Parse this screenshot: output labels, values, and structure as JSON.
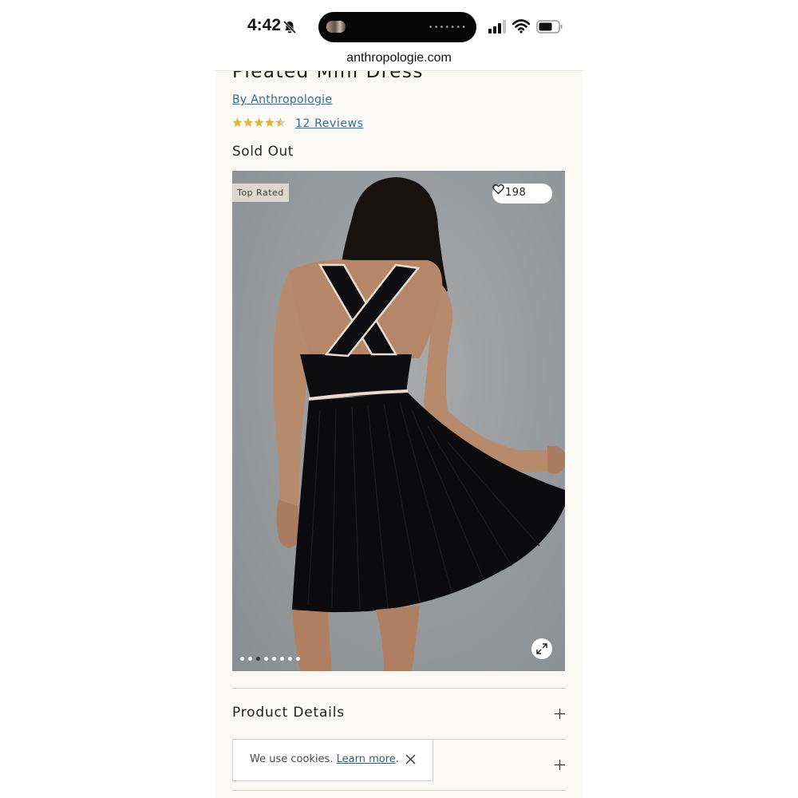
{
  "status_bar": {
    "time": "4:42",
    "island_dots": "•••••••"
  },
  "browser": {
    "url": "anthropologie.com"
  },
  "product": {
    "title": "Pleated Mini Dress",
    "brand_link": "By Anthropologie",
    "rating": 4.5,
    "rating_max": 5,
    "reviews_link": "12 Reviews",
    "availability": "Sold Out"
  },
  "gallery": {
    "badge": "Top Rated",
    "like_count": "198",
    "image_count": 8,
    "active_index": 2
  },
  "sections": [
    {
      "label": "Product Details"
    }
  ],
  "cookie_banner": {
    "text": "We use cookies. ",
    "link": "Learn more",
    "suffix": "."
  },
  "icons": [
    "bell-off-icon",
    "signal-icon",
    "wifi-icon",
    "battery-icon",
    "star-icon",
    "heart-icon",
    "expand-icon",
    "plus-icon",
    "close-icon"
  ],
  "colors": {
    "link": "#2d6f93",
    "star": "#e0b43a",
    "page_bg": "#fbfaf6"
  }
}
